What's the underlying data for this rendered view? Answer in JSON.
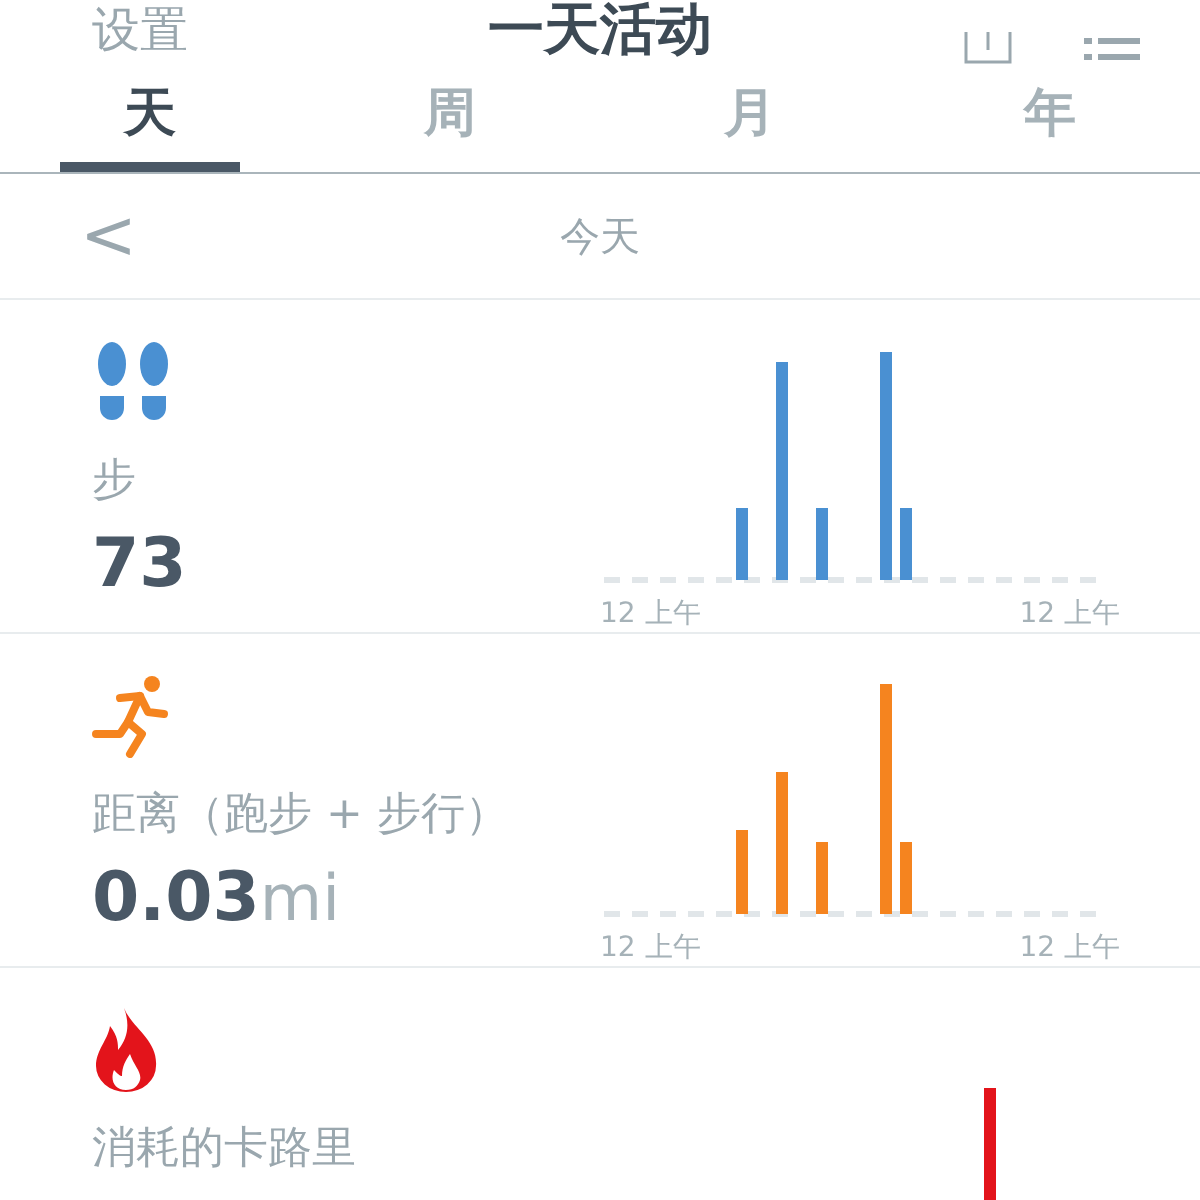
{
  "header": {
    "left_label": "设置",
    "title": "一天活动"
  },
  "tabs": [
    {
      "label": "天",
      "selected": true
    },
    {
      "label": "周",
      "selected": false
    },
    {
      "label": "月",
      "selected": false
    },
    {
      "label": "年",
      "selected": false
    }
  ],
  "date_nav": {
    "back": "<",
    "label": "今天"
  },
  "metrics": [
    {
      "kind": "steps",
      "color": "#4a90d2",
      "label": "步",
      "value": "73",
      "axis_start": "12 上午",
      "axis_end": "12 上午"
    },
    {
      "kind": "distance",
      "color": "#f5841f",
      "label": "距离（跑步 + 步行）",
      "value": "0.03",
      "unit": "mi",
      "axis_start": "12 上午",
      "axis_end": "12 上午"
    },
    {
      "kind": "calories",
      "color": "#e3141b",
      "label": "消耗的卡路里"
    }
  ]
}
